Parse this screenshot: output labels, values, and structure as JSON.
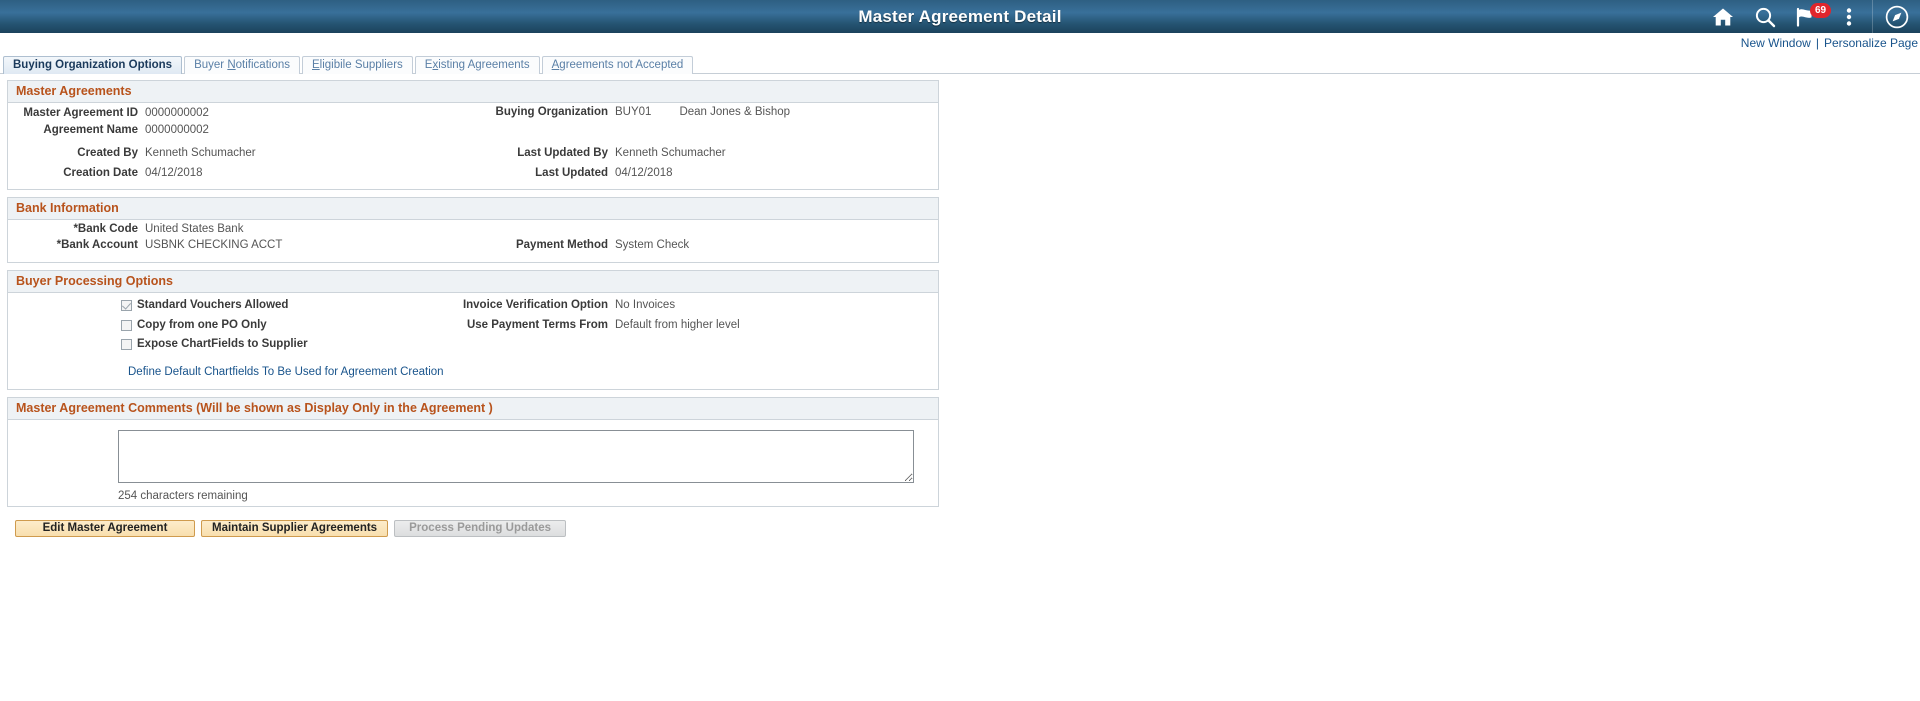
{
  "header": {
    "title": "Master Agreement Detail",
    "icons": [
      {
        "name": "home-icon",
        "label": "Home"
      },
      {
        "name": "search-icon",
        "label": "Search"
      },
      {
        "name": "notifications-flag-icon",
        "label": "Notifications",
        "badge": "69"
      },
      {
        "name": "actions-menu-icon",
        "label": "Actions"
      },
      {
        "name": "navbar-compass-icon",
        "label": "NavBar"
      }
    ],
    "colors": {
      "header_start": "#39709a",
      "header_end": "#1b425c",
      "badge": "#e0262c",
      "link": "#19548c",
      "section_title": "#b8531c"
    }
  },
  "toolbar_links": {
    "new_window": "New Window",
    "separator": "|",
    "personalize_page": "Personalize Page"
  },
  "tabs": [
    {
      "label": "Buying Organization Options",
      "accel": "",
      "active": true
    },
    {
      "label": "Buyer Notifications",
      "accel": "N",
      "active": false
    },
    {
      "label": "Eligibile Suppliers",
      "accel": "E",
      "active": false
    },
    {
      "label": "Existing Agreements",
      "accel": "x",
      "active": false
    },
    {
      "label": "Agreements not Accepted",
      "accel": "A",
      "active": false
    }
  ],
  "master_agreements": {
    "title": "Master Agreements",
    "fields": {
      "master_agreement_id_label": "Master Agreement ID",
      "master_agreement_id_value": "0000000002",
      "agreement_name_label": "Agreement Name",
      "agreement_name_value": "0000000002",
      "buying_organization_label": "Buying Organization",
      "buying_organization_code": "BUY01",
      "buying_organization_name": "Dean Jones & Bishop",
      "created_by_label": "Created By",
      "created_by_value": "Kenneth Schumacher",
      "creation_date_label": "Creation Date",
      "creation_date_value": "04/12/2018",
      "last_updated_by_label": "Last Updated By",
      "last_updated_by_value": "Kenneth Schumacher",
      "last_updated_label": "Last Updated",
      "last_updated_value": "04/12/2018"
    }
  },
  "bank_information": {
    "title": "Bank Information",
    "fields": {
      "bank_code_label": "*Bank Code",
      "bank_code_value": "United States Bank",
      "bank_account_label": "*Bank Account",
      "bank_account_value": "USBNK CHECKING ACCT",
      "payment_method_label": "Payment Method",
      "payment_method_value": "System Check"
    }
  },
  "buyer_processing_options": {
    "title": "Buyer Processing Options",
    "checkboxes": [
      {
        "label": "Standard Vouchers Allowed",
        "checked": true
      },
      {
        "label": "Copy from one PO Only",
        "checked": false
      },
      {
        "label": "Expose ChartFields to Supplier",
        "checked": false
      }
    ],
    "fields": {
      "invoice_verification_label": "Invoice Verification Option",
      "invoice_verification_value": "No Invoices",
      "payment_terms_label": "Use Payment Terms From",
      "payment_terms_value": "Default from higher level"
    },
    "chartfields_link": "Define Default Chartfields To Be Used for Agreement Creation"
  },
  "comments": {
    "title": "Master Agreement Comments (Will be shown as Display Only in the Agreement )",
    "textarea_value": "",
    "textarea_placeholder": "",
    "characters_remaining": "254 characters remaining"
  },
  "buttons": [
    {
      "label": "Edit Master Agreement",
      "name": "edit-master-agreement-button",
      "disabled": false
    },
    {
      "label": "Maintain Supplier Agreements",
      "name": "maintain-supplier-agreements-button",
      "disabled": false
    },
    {
      "label": "Process Pending Updates",
      "name": "process-pending-updates-button",
      "disabled": true
    }
  ]
}
